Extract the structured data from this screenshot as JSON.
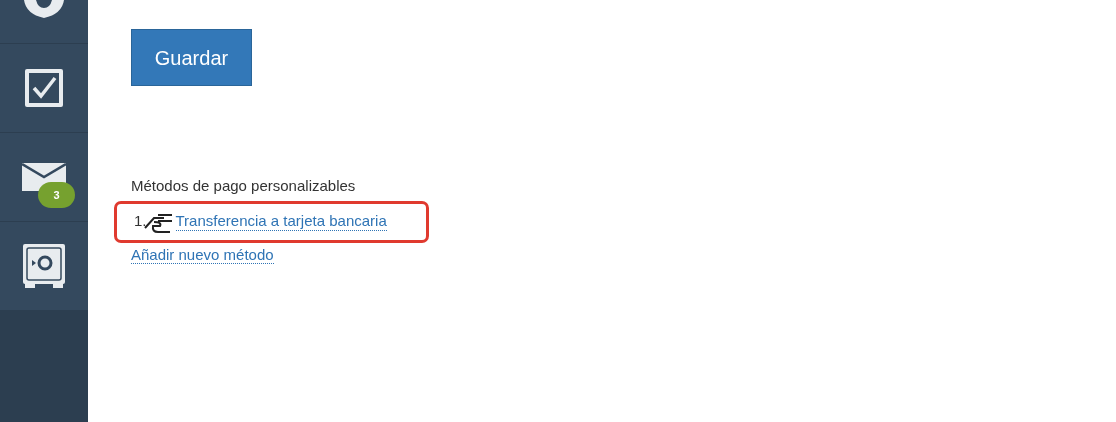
{
  "sidebar": {
    "items": [
      {
        "kind": "user"
      },
      {
        "kind": "tasks"
      },
      {
        "kind": "mail",
        "badge": "3"
      },
      {
        "kind": "safe"
      }
    ]
  },
  "save_button": "Guardar",
  "payment_methods": {
    "title": "Métodos de pago personalizables",
    "items": [
      {
        "number": "1.",
        "label": "Transferencia a tarjeta bancaria",
        "highlighted": true
      }
    ],
    "add_link": "Añadir nuevo método"
  }
}
